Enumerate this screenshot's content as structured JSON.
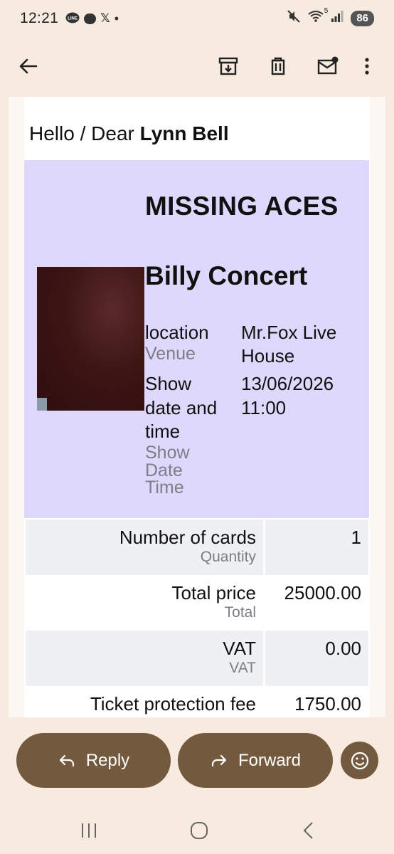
{
  "status_bar": {
    "time": "12:21",
    "notification_icons": [
      "line-icon",
      "chat-bubble-icon",
      "x-icon",
      "dot-icon"
    ],
    "line_label": "LINE",
    "x_label": "𝕏",
    "dot": "•",
    "network": "5",
    "battery": "86"
  },
  "toolbar": {
    "back": "back-arrow-icon",
    "archive": "archive-icon",
    "delete": "trash-icon",
    "mark_unread": "mark-unread-icon",
    "more": "more-vert-icon"
  },
  "email": {
    "greeting_prefix": "Hello / Dear ",
    "recipient_name": "Lynn Bell",
    "ticket": {
      "artist": "MISSING ACES",
      "event": "Billy Concert",
      "location_label": "location",
      "location_sub": "Venue",
      "location_value_line1": "Mr.Fox Live",
      "location_value_line2": "House",
      "show_label_line1": "Show",
      "show_label_line2": "date and",
      "show_label_line3": "time",
      "show_sub_line1": "Show",
      "show_sub_line2": "Date",
      "show_sub_line3": "Time",
      "show_value_line1": "13/06/2026",
      "show_value_line2": "11:00"
    },
    "summary": [
      {
        "label": "Number of cards",
        "sub": "Quantity",
        "value": "1"
      },
      {
        "label": "Total price",
        "sub": "Total",
        "value": "25000.00"
      },
      {
        "label": "VAT",
        "sub": "VAT",
        "value": "0.00"
      },
      {
        "label": "Ticket protection fee",
        "sub": "",
        "value": "1750.00"
      }
    ]
  },
  "actions": {
    "reply_label": "Reply",
    "forward_label": "Forward"
  },
  "colors": {
    "background": "#f7ebe0",
    "ticket_bg": "#ddd8fc",
    "button_bg": "#735a3e",
    "shaded_row": "#eef0f4"
  }
}
